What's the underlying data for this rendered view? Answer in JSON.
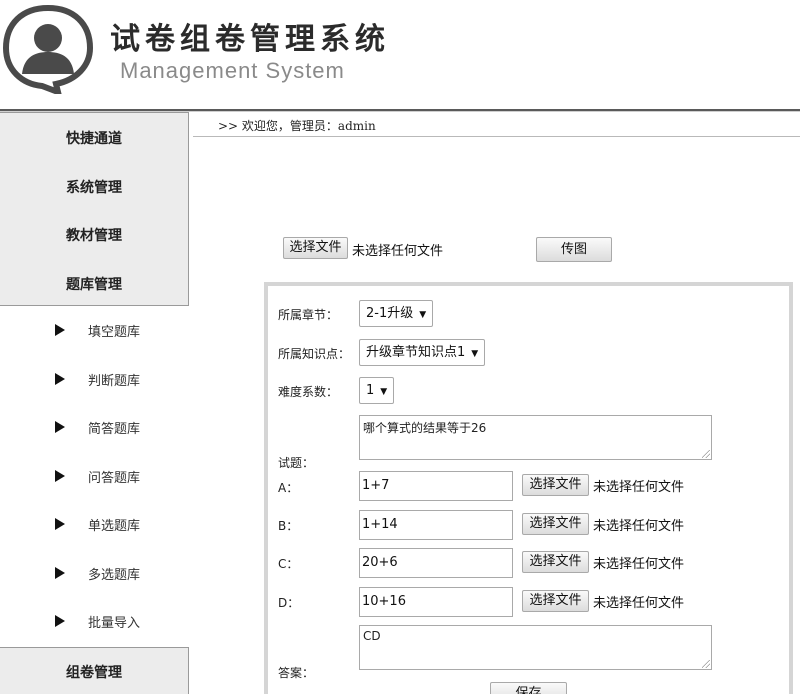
{
  "header": {
    "title": "试卷组卷管理系统",
    "subtitle": "Management System"
  },
  "sidebar": {
    "top_items": [
      "快捷通道",
      "系统管理",
      "教材管理",
      "题库管理"
    ],
    "sub_items": [
      "填空题库",
      "判断题库",
      "简答题库",
      "问答题库",
      "单选题库",
      "多选题库",
      "批量导入"
    ],
    "bottom_items": [
      "组卷管理"
    ]
  },
  "welcome": ">> 欢迎您，管理员：admin",
  "upload": {
    "choose_file": "选择文件",
    "no_file": "未选择任何文件",
    "upload_image": "传图"
  },
  "form": {
    "chapter_label": "所属章节：",
    "chapter_value": "2-1升级",
    "knowledge_label": "所属知识点：",
    "knowledge_value": "升级章节知识点1",
    "difficulty_label": "难度系数：",
    "difficulty_value": "1",
    "question_label": "试题：",
    "question_value": "哪个算式的结果等于26",
    "options": [
      {
        "label": "A：",
        "value": "1+7"
      },
      {
        "label": "B：",
        "value": "1+14"
      },
      {
        "label": "C：",
        "value": "20+6"
      },
      {
        "label": "D：",
        "value": "10+16"
      }
    ],
    "answer_label": "答案：",
    "answer_value": "CD",
    "save_label": "保存"
  }
}
